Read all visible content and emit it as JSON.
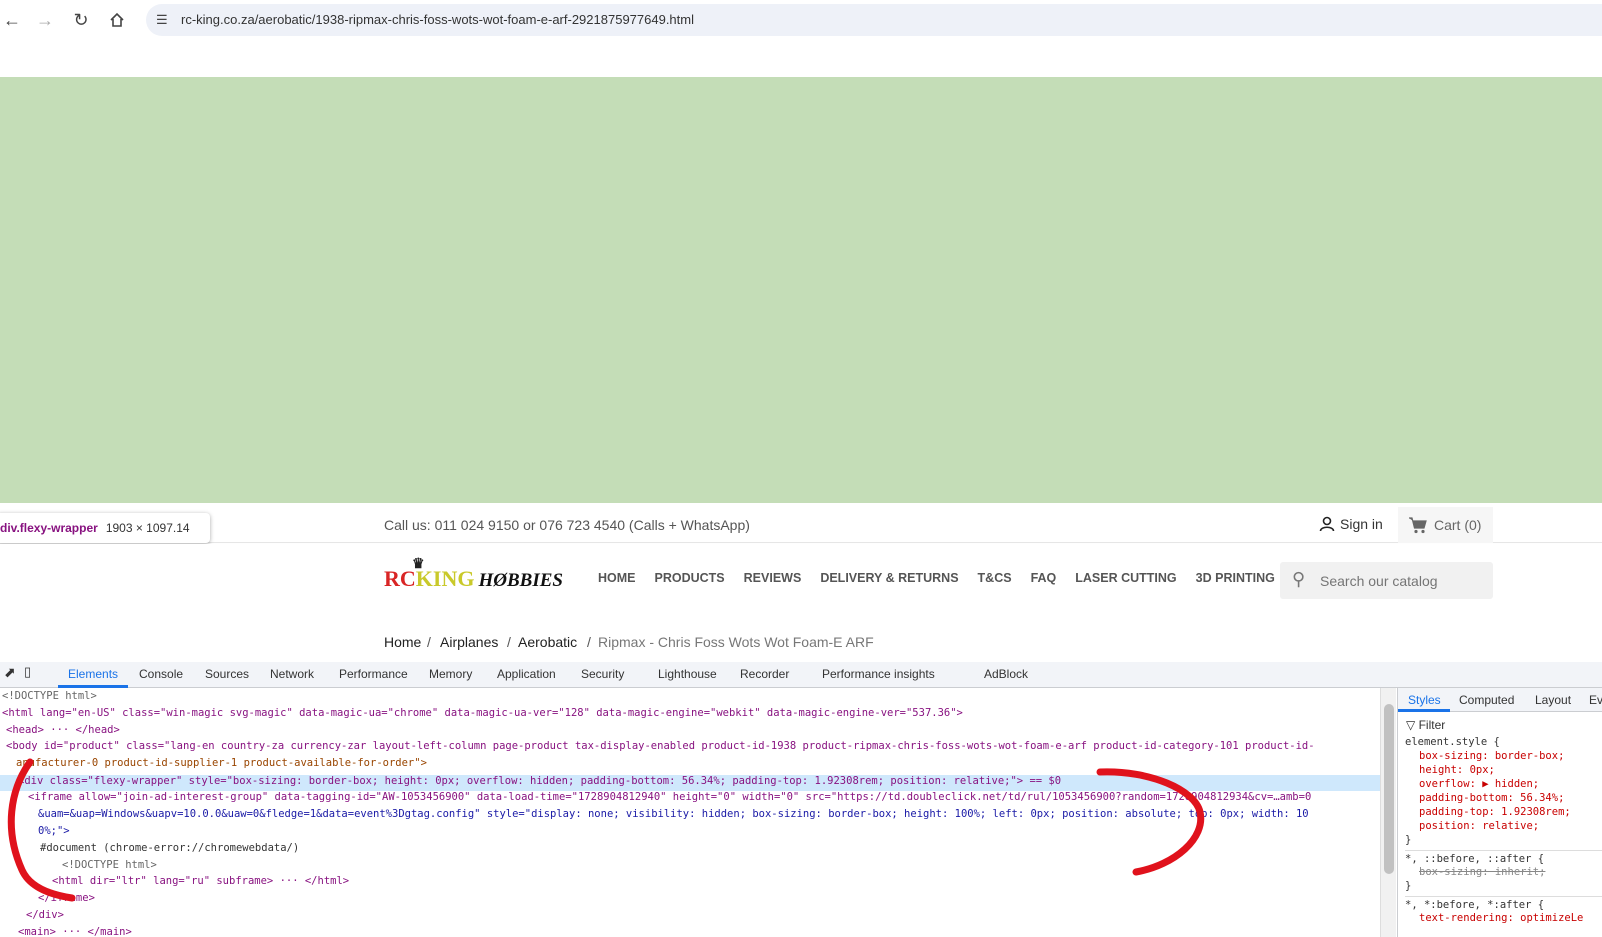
{
  "browser": {
    "url": "rc-king.co.za/aerobatic/1938-ripmax-chris-foss-wots-wot-foam-e-arf-2921875977649.html",
    "back_icon": "arrow-left-icon",
    "forward_icon": "arrow-right-icon",
    "reload_icon": "reload-icon",
    "home_icon": "home-icon",
    "site_info_icon": "tune-icon"
  },
  "tooltip": {
    "selector": "div.flexy-wrapper",
    "size": "1903 × 1097.14"
  },
  "site": {
    "call": "Call us: 011 024 9150 or 076 723 4540 (Calls + WhatsApp)",
    "signin": "Sign in",
    "cart": "Cart (0)",
    "logo": {
      "rc": "RC",
      "king": "KING",
      "hobbies": "HØBBIES"
    },
    "menu": [
      "HOME",
      "PRODUCTS",
      "REVIEWS",
      "DELIVERY & RETURNS",
      "T&CS",
      "FAQ",
      "LASER CUTTING",
      "3D PRINTING"
    ],
    "search_placeholder": "Search our catalog",
    "breadcrumb": [
      "Home",
      "/",
      "Airplanes",
      "/",
      "Aerobatic",
      "/",
      "Ripmax - Chris Foss Wots Wot Foam-E ARF"
    ]
  },
  "devtools": {
    "tabs": [
      "Elements",
      "Console",
      "Sources",
      "Network",
      "Performance",
      "Memory",
      "Application",
      "Security",
      "Lighthouse",
      "Recorder",
      "Performance insights",
      "AdBlock"
    ],
    "styles_tabs": [
      "Styles",
      "Computed",
      "Layout",
      "Ev"
    ],
    "filter": "Filter",
    "lines": {
      "l1": "<!DOCTYPE html>",
      "l2": "<html lang=\"en-US\" class=\"win-magic svg-magic\" data-magic-ua=\"chrome\" data-magic-ua-ver=\"128\" data-magic-engine=\"webkit\" data-magic-engine-ver=\"537.36\">",
      "l3": "<head> ··· </head>",
      "l4": "<body id=\"product\" class=\"lang-en country-za currency-zar layout-left-column page-product tax-display-enabled product-id-1938 product-ripmax-chris-foss-wots-wot-foam-e-arf product-id-category-101 product-id-",
      "l5": "anufacturer-0 product-id-supplier-1 product-available-for-order\">",
      "l6": "<div class=\"flexy-wrapper\" style=\"box-sizing: border-box; height: 0px; overflow: hidden; padding-bottom: 56.34%; padding-top: 1.92308rem; position: relative;\"> == $0",
      "l7": "<iframe allow=\"join-ad-interest-group\" data-tagging-id=\"AW-1053456900\" data-load-time=\"1728904812940\" height=\"0\" width=\"0\" src=\"https://td.doubleclick.net/td/rul/1053456900?random=1728904812934&cv=…amb=0",
      "l8": "&uam=&uap=Windows&uapv=10.0.0&uaw=0&fledge=1&data=event%3Dgtag.config\" style=\"display: none; visibility: hidden; box-sizing: border-box; height: 100%; left: 0px; position: absolute; top: 0px; width: 10",
      "l9": "0%;\">",
      "l10": "#document (chrome-error://chromewebdata/)",
      "l11": "<!DOCTYPE html>",
      "l12": "<html dir=\"ltr\" lang=\"ru\" subframe> ··· </html>",
      "l13": "</iframe>",
      "l14": "</div>",
      "l15": "<main> ··· </main>"
    },
    "styles_lines": {
      "s1": "element.style {",
      "s2": "box-sizing: border-box;",
      "s3": "height: 0px;",
      "s4": "overflow: ▶ hidden;",
      "s5": "padding-bottom: 56.34%;",
      "s6": "padding-top: 1.92308rem;",
      "s7": "position: relative;",
      "s8": "}",
      "s9": "*, ::before, ::after {",
      "s10": "box-sizing: inherit;",
      "s11": "}",
      "s12": "*, *:before, *:after {",
      "s13": "text-rendering: optimizeLe"
    }
  },
  "colors": {
    "green_area": "#c4ddb7",
    "annotation": "#e0121c",
    "accent": "#1a73e8"
  }
}
